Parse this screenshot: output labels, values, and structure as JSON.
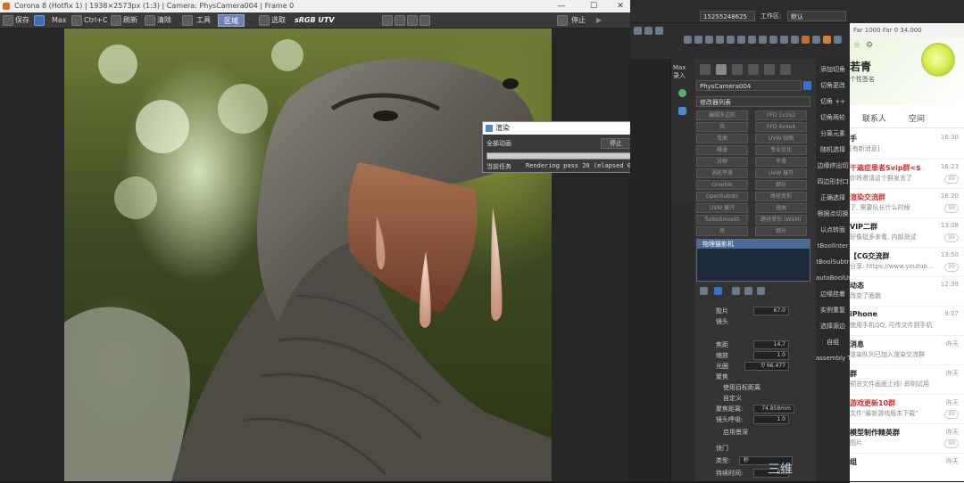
{
  "vfb": {
    "title": "Corona 8 (Hotfix 1) | 1938×2573px (1:3) | Camera: PhysCamera004 | Frame 0",
    "toolbar": {
      "save": "保存",
      "max": "Max",
      "copy": "Ctrl+C",
      "refresh": "刷新",
      "clear": "清除",
      "tools": "工具",
      "region": "区域",
      "pick": "选取",
      "colorspace": "sRGB UTV",
      "stop": "停止"
    }
  },
  "dialog": {
    "title": "渲染",
    "total_label": "全部动画",
    "stop_button": "停止",
    "cancel_button": "取消",
    "progress": 0.0,
    "current_task_label": "当前任务",
    "current_task_value": "Rendering pass 20 (elapsed 0 00:00)"
  },
  "max": {
    "user": "15255248625",
    "workspace_label": "工作区:",
    "workspace_value": "默认",
    "object_name": "PhysCamera004",
    "modifier_list": "修改器列表",
    "modifier_buttons": [
      [
        "编辑多边形",
        "FFD 2x2x2"
      ],
      [
        "壳",
        "FFD 4x4x4"
      ],
      [
        "弯曲",
        "UVW 贴图"
      ],
      [
        "噪波",
        "专业优化"
      ],
      [
        "对称",
        "平滑"
      ],
      [
        "涡轮平滑",
        "UVW 展开"
      ],
      [
        "Greeble",
        "细分"
      ],
      [
        "OpenSubdiv",
        "路径变形"
      ],
      [
        "UVW 展开",
        "扭曲"
      ],
      [
        "TurboSmooth",
        "路径变形 (WSM)"
      ],
      [
        "壳",
        "细分"
      ]
    ],
    "stack_item": "物理摄影机",
    "props": {
      "film_label": "胶片",
      "film_value": "67.0",
      "lens_label": "镜头",
      "focal_label": "焦距",
      "focal_value": "14.7",
      "zoom_label": "缩放",
      "zoom_value": "1.0",
      "aperture_label": "光圈",
      "aperture_value": "f/ 66.477",
      "focus_label": "聚焦",
      "use_target": "使用目标距离",
      "custom": "自定义",
      "focus_dist_label": "聚焦距离:",
      "focus_dist_value": "74.858mm",
      "lens_breath_label": "镜头呼吸:",
      "lens_breath_value": "1.0",
      "enable_dof": "启用景深",
      "shutter_label": "快门",
      "shutter_type_label": "类型:",
      "shutter_type_value": "秒",
      "duration_label": "持续时间:",
      "duration_value": "0.5"
    },
    "right_buttons": [
      "添加切角",
      "切角更改",
      "切角 ++",
      "切角两轮",
      "分离元素",
      "随机选择",
      "边缘挤出切",
      "四边形封口",
      "正确选择",
      "根据点切换",
      "以点转面",
      "tBoolInter",
      "tBoolSubtr",
      "autoBoolUni",
      "边缘挂着",
      "实例重复",
      "选择源边",
      "自组",
      "assembly Too"
    ]
  },
  "qq": {
    "strip": "Far 1000  Far 0  34.000",
    "header_name": "若青",
    "header_sub": "个性签名",
    "tabs": [
      "联系人",
      "空间"
    ],
    "items": [
      {
        "name": "手",
        "msg": "[有新消息]",
        "time": "16:30",
        "badge": "",
        "red": false
      },
      {
        "name": "干遍症患者Svip群<$",
        "msg": "你将邀请这个群发言了",
        "time": "16:23",
        "badge": "99",
        "red": true
      },
      {
        "name": "渲染交流群",
        "msg": "了, 需要队长什么时候",
        "time": "16:20",
        "badge": "99",
        "red": true
      },
      {
        "name": "VIP二群",
        "msg": "好像挺多来看, 内部测试",
        "time": "13:08",
        "badge": "99",
        "red": false
      },
      {
        "name": "【CG交流群",
        "msg": "分享: https://www.youtub...",
        "time": "13:50",
        "badge": "99",
        "red": false
      },
      {
        "name": "动态",
        "msg": "改变了面貌",
        "time": "12:39",
        "badge": "",
        "red": false
      },
      {
        "name": "iPhone",
        "msg": "使用手机QQ, 可传文件到手机",
        "time": "9:07",
        "badge": "",
        "red": false
      },
      {
        "name": "消息",
        "msg": "渲染队列已加入渲染交流群",
        "time": "昨天",
        "badge": "",
        "red": false
      },
      {
        "name": "群",
        "msg": "预览文件画面上线! 即刻试用",
        "time": "昨天",
        "badge": "",
        "red": false
      },
      {
        "name": "游戏更新10群",
        "msg": "文件\"最新游戏版本下载\"",
        "time": "昨天",
        "badge": "99",
        "red": true
      },
      {
        "name": "模型制作精英群",
        "msg": "图片",
        "time": "昨天",
        "badge": "99",
        "red": false
      },
      {
        "name": "组",
        "msg": "",
        "time": "昨天",
        "badge": "",
        "red": false
      }
    ]
  },
  "watermark": "三维"
}
